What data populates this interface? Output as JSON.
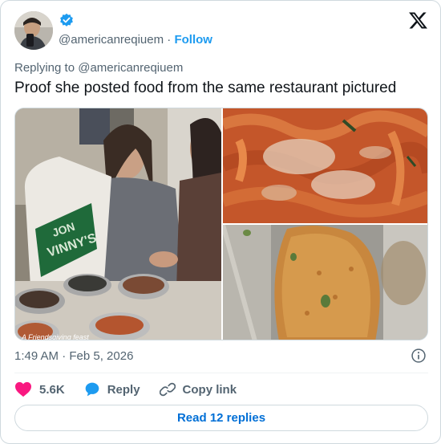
{
  "author": {
    "handle": "@americanreqiuem",
    "separator": "·",
    "follow_label": "Follow"
  },
  "reply_context": "Replying to @americanreqiuem",
  "tweet": {
    "text": "Proof she posted food from the same restaurant pictured",
    "timestamp": "1:49 AM · Feb 5, 2026"
  },
  "media": {
    "photos": [
      {
        "caption": "A Friendsgiving feast",
        "bag_text": [
          "JON",
          "VINNY'S"
        ]
      },
      {
        "caption": ""
      },
      {
        "caption": ""
      }
    ]
  },
  "actions": {
    "likes": "5.6K",
    "reply_label": "Reply",
    "copy_label": "Copy link"
  },
  "read_replies_label": "Read 12 replies",
  "colors": {
    "accent": "#1d9bf0",
    "link_button": "#006fd6",
    "heart": "#f91880",
    "muted_text": "#536471",
    "border": "#cfd9de"
  },
  "icons": [
    "verified-badge-icon",
    "x-logo-icon",
    "info-icon",
    "heart-icon",
    "reply-bubble-icon",
    "link-icon"
  ]
}
